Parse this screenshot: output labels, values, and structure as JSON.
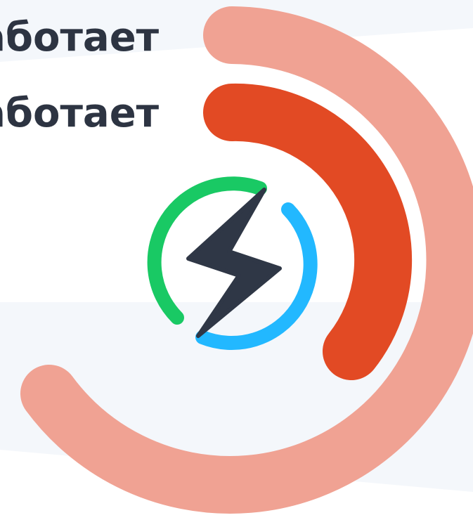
{
  "headlines": [
    {
      "text": "работает"
    },
    {
      "text": "работает"
    }
  ],
  "colors": {
    "background": "#ffffff",
    "band": "#f4f7fb",
    "text": "#2d3442",
    "outer_ring": "#f0a293",
    "inner_ring": "#e24a24",
    "green_arc": "#19c964",
    "blue_arc": "#22b8ff",
    "bolt": "#2f3746"
  },
  "icons": {
    "center": "lightning-bolt-icon"
  }
}
